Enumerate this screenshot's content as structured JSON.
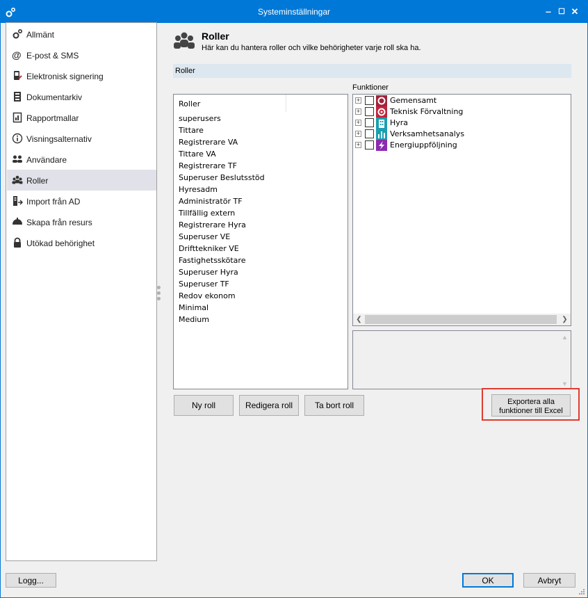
{
  "window": {
    "title": "Systeminställningar",
    "controls": {
      "minimize": "‒",
      "maximize": "☐",
      "close": "✕"
    }
  },
  "sidebar": {
    "items": [
      {
        "label": "Allmänt",
        "icon": "gears-icon"
      },
      {
        "label": "E-post & SMS",
        "icon": "at-sign-icon"
      },
      {
        "label": "Elektronisk signering",
        "icon": "signature-device-icon"
      },
      {
        "label": "Dokumentarkiv",
        "icon": "document-archive-icon"
      },
      {
        "label": "Rapportmallar",
        "icon": "report-template-icon"
      },
      {
        "label": "Visningsalternativ",
        "icon": "info-icon"
      },
      {
        "label": "Användare",
        "icon": "users-icon"
      },
      {
        "label": "Roller",
        "icon": "roles-icon",
        "selected": true
      },
      {
        "label": "Import från AD",
        "icon": "import-ad-icon"
      },
      {
        "label": "Skapa från resurs",
        "icon": "create-from-resource-icon"
      },
      {
        "label": "Utökad behörighet",
        "icon": "lock-icon"
      }
    ]
  },
  "header": {
    "title": "Roller",
    "description": "Här kan du hantera roller och vilke behörigheter varje roll ska ha."
  },
  "section": {
    "label": "Roller"
  },
  "roles": {
    "column_header": "Roller",
    "items": [
      "superusers",
      "Tittare",
      "Registrerare VA",
      "Tittare VA",
      "Registrerare TF",
      "Superuser Beslutsstöd",
      "Hyresadm",
      "Administratör TF",
      "Tillfällig extern",
      "Registrerare Hyra",
      "Superuser VE",
      "Drifttekniker VE",
      "Fastighetsskötare",
      "Superuser Hyra",
      "Superuser TF",
      "Redov ekonom",
      "Minimal",
      "Medium"
    ]
  },
  "functions": {
    "label": "Funktioner",
    "items": [
      {
        "label": "Gemensamt",
        "color": "#a0243c",
        "icon": "common-icon"
      },
      {
        "label": "Teknisk Förvaltning",
        "color": "#c0243c",
        "icon": "technical-management-icon"
      },
      {
        "label": "Hyra",
        "color": "#1a9fb0",
        "icon": "building-icon"
      },
      {
        "label": "Verksamhetsanalys",
        "color": "#1a9fb0",
        "icon": "analysis-icon"
      },
      {
        "label": "Energiuppföljning",
        "color": "#8c2bb0",
        "icon": "energy-icon"
      }
    ]
  },
  "buttons": {
    "new_role": "Ny roll",
    "edit_role": "Redigera roll",
    "delete_role": "Ta bort roll",
    "export_line1": "Exportera alla",
    "export_line2": "funktioner till Excel",
    "log": "Logg...",
    "ok": "OK",
    "cancel": "Avbryt"
  },
  "colors": {
    "titlebar": "#0078d7",
    "selection": "#e1e1e9",
    "highlight": "#e03c2f",
    "section_bar": "#dde7f0"
  }
}
